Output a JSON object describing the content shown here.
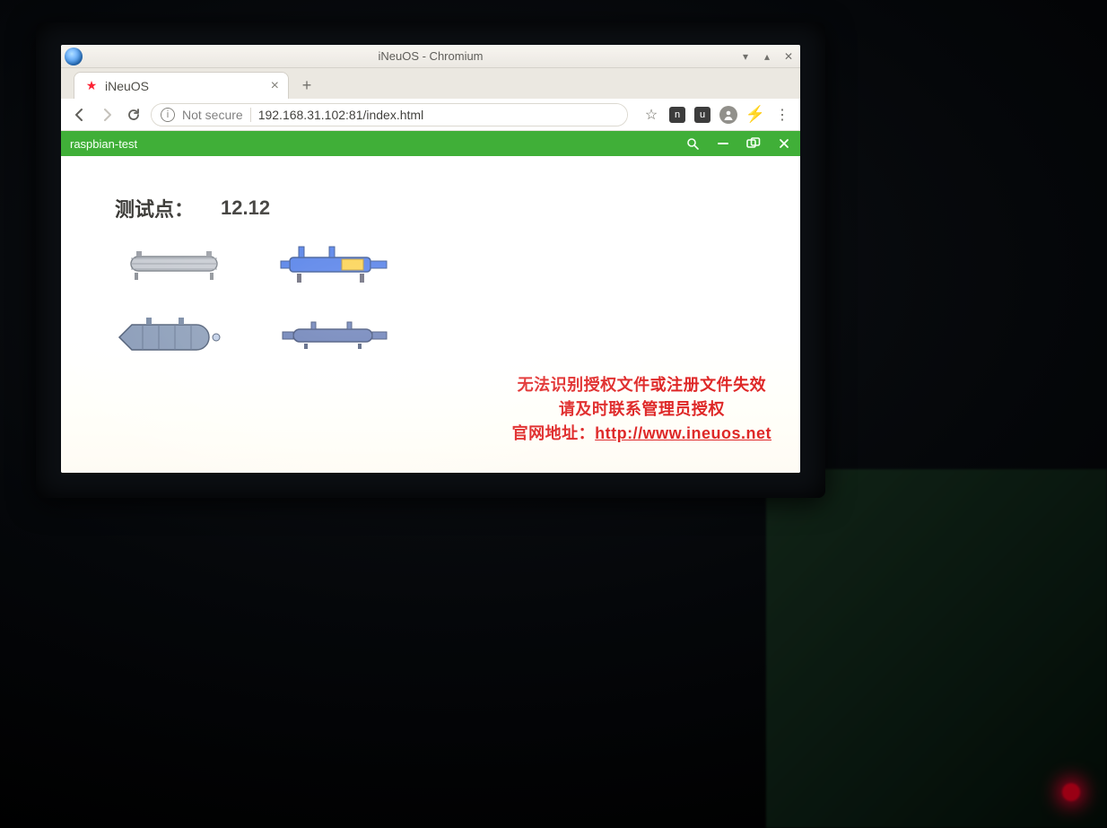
{
  "window": {
    "title": "iNeuOS - Chromium"
  },
  "tab": {
    "title": "iNeuOS"
  },
  "omnibox": {
    "security_label": "Not secure",
    "url": "192.168.31.102:81/index.html"
  },
  "extensions": {
    "badge1": "n",
    "badge2": "u"
  },
  "app": {
    "title": "raspbian-test"
  },
  "content": {
    "test_label": "测试点：",
    "test_value": "12.12"
  },
  "license": {
    "line1": "无法识别授权文件或注册文件失效",
    "line2": "请及时联系管理员授权",
    "line3_prefix": "官网地址：",
    "line3_url": "http://www.ineuos.net"
  }
}
